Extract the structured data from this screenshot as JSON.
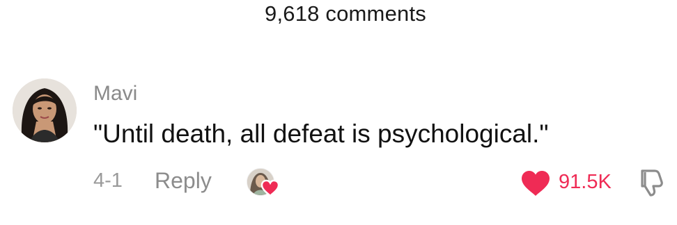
{
  "header": {
    "comments_count_label": "9,618 comments"
  },
  "comment": {
    "username": "Mavi",
    "text": "\"Until death, all defeat is psychological.\"",
    "date": "4-1",
    "reply_label": "Reply",
    "like_count": "91.5K",
    "liked_by_creator": true
  },
  "icons": {
    "avatar": "avatar",
    "creator_avatar": "creator-avatar",
    "creator_heart": "heart-icon",
    "like": "heart-icon",
    "dislike": "thumbs-down-icon"
  },
  "colors": {
    "like": "#ef2b55",
    "muted_text": "#8a8a8a",
    "text": "#111111"
  }
}
